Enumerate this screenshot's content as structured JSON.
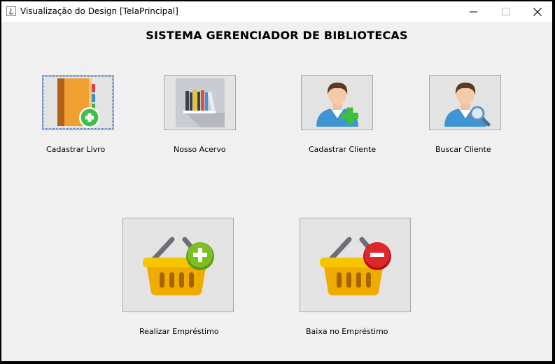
{
  "window": {
    "title": "Visualização do Design [TelaPrincipal]",
    "controls": [
      "minimize-icon",
      "maximize-icon",
      "close-icon"
    ]
  },
  "main": {
    "heading": "SISTEMA GERENCIADOR DE BIBLIOTECAS",
    "actions": [
      {
        "label": "Cadastrar Livro",
        "icon": "add-book-icon"
      },
      {
        "label": "Nosso Acervo",
        "icon": "bookshelf-icon"
      },
      {
        "label": "Cadastrar Cliente",
        "icon": "add-user-icon"
      },
      {
        "label": "Buscar Cliente",
        "icon": "search-user-icon"
      },
      {
        "label": "Realizar Empréstimo",
        "icon": "basket-add-icon"
      },
      {
        "label": "Baixa no Empréstimo",
        "icon": "basket-remove-icon"
      }
    ]
  },
  "colors": {
    "titlebar": "#ffffff",
    "background": "#f0f0f0",
    "tile": "#e3e3e3",
    "book_orange": "#f0a030",
    "plus_green": "#3fc04a",
    "user_blue": "#3d95d4",
    "basket_yellow": "#f5b800",
    "minus_red": "#e0262d"
  }
}
